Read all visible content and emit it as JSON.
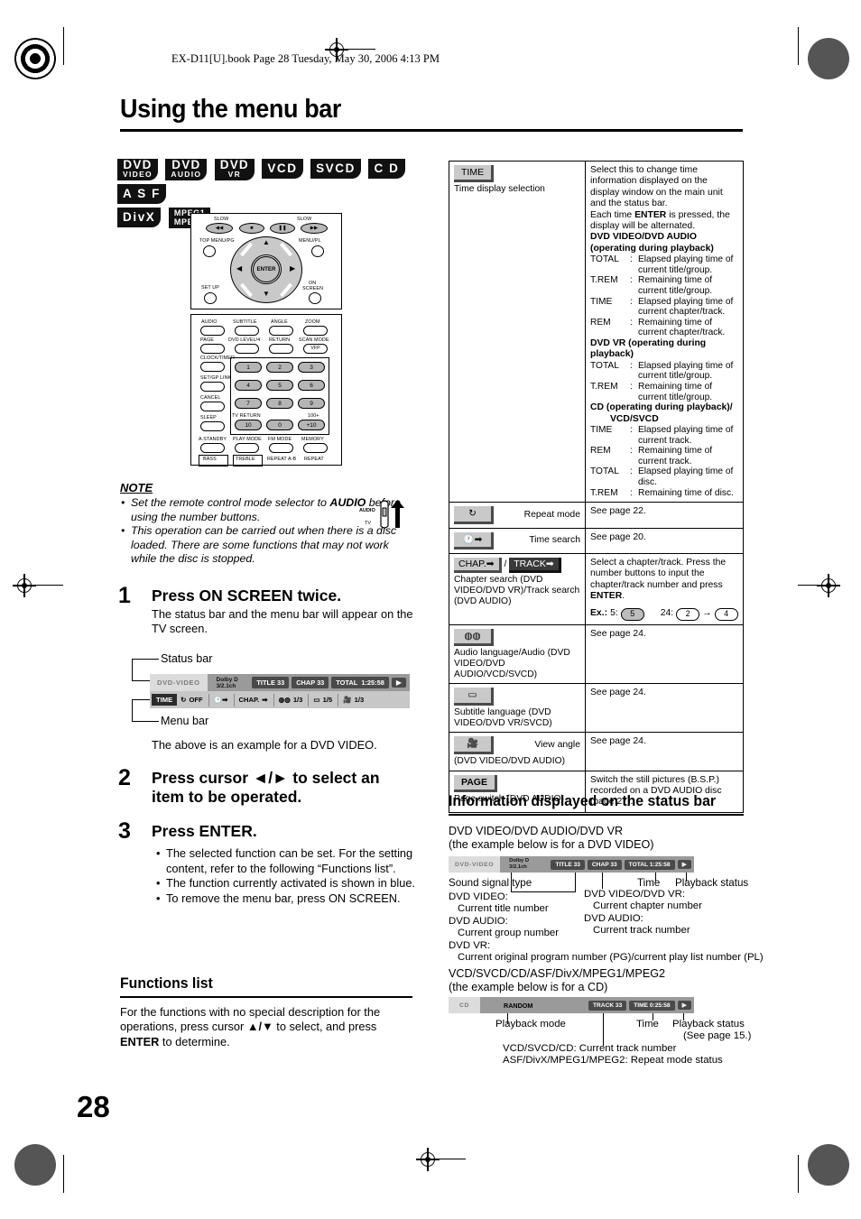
{
  "header": {
    "book_line": "EX-D11[U].book  Page 28  Tuesday, May 30, 2006  4:13 PM",
    "title": "Using the menu bar",
    "page_number": "28"
  },
  "badges": [
    {
      "line1": "DVD",
      "line2": "VIDEO"
    },
    {
      "line1": "DVD",
      "line2": "AUDIO"
    },
    {
      "line1": "DVD",
      "line2": "VR"
    },
    {
      "line1": "VCD",
      "line2": ""
    },
    {
      "line1": "SVCD",
      "line2": ""
    },
    {
      "line1": "C D",
      "line2": ""
    },
    {
      "line1": "A S F",
      "line2": ""
    },
    {
      "line1": "DivX",
      "line2": ""
    },
    {
      "line1": "MPEG1",
      "line2": "MPEG2"
    }
  ],
  "remote": {
    "slow_left": "SLOW",
    "slow_right": "SLOW",
    "top_menu": "TOP MENU/PG",
    "menu_pl": "MENU/PL",
    "set_up": "SET UP",
    "on_screen_l1": "ON",
    "on_screen_l2": "SCREEN",
    "enter": "ENTER",
    "row_labels": [
      "AUDIO",
      "SUBTITLE",
      "ANGLE",
      "ZOOM",
      "PAGE",
      "DVD LEVEL/4",
      "RETURN",
      "SCAN MODE",
      "CLOCK/TIMER",
      "SET/GP LINK",
      "CANCEL",
      "SLEEP",
      "TV RETURN",
      "100+",
      "A.STANDBY",
      "PLAY MODE",
      "FM MODE",
      "MEMORY",
      "BASS",
      "TREBLE",
      "REPEAT A-B",
      "REPEAT"
    ],
    "vfp": "VFP",
    "number_keys": [
      "1",
      "2",
      "3",
      "4",
      "5",
      "6",
      "7",
      "8",
      "9",
      "10",
      "0",
      "+10"
    ]
  },
  "note": {
    "heading": "NOTE",
    "items": [
      {
        "pre": "Set the remote control mode selector to ",
        "bold": "AUDIO",
        "post": " before using the number buttons."
      },
      {
        "pre": "This operation can be carried out when there is a disc loaded. There are some functions that may not work while the disc is stopped.",
        "bold": "",
        "post": ""
      }
    ],
    "selector_top": "AUDIO",
    "selector_bottom": "TV"
  },
  "steps": [
    {
      "num": "1",
      "head": "Press ON SCREEN twice.",
      "body": "The status bar and the menu bar will appear on the TV screen."
    },
    {
      "num": "2",
      "head": "Press cursor ◄/► to select an item to be operated."
    },
    {
      "num": "3",
      "head": "Press ENTER."
    }
  ],
  "step1_labels": {
    "status_bar": "Status bar",
    "menu_bar": "Menu bar",
    "caption": "The above is an example for a DVD VIDEO."
  },
  "step3_bullets": [
    "The selected function can be set. For the setting content, refer to the following “Functions list”.",
    "The function currently activated is shown in blue.",
    "To remove the menu bar, press ON SCREEN."
  ],
  "functions_list": {
    "heading": "Functions list",
    "body_1": "For the functions with no special description for the operations, press cursor ",
    "body_arrows": "▲/▼",
    "body_2": " to select, and press ",
    "body_bold": "ENTER",
    "body_3": " to determine."
  },
  "example_statusbar": {
    "disc": "DVD-VIDEO",
    "signal_l1": "Dolby D",
    "signal_l2": "3/2.1ch",
    "title": "TITLE 33",
    "chap": "CHAP 33",
    "total_label": "TOTAL",
    "total_value": "1:25:58",
    "play_icon": "▶"
  },
  "example_menubar": {
    "time": "TIME",
    "repeat": "OFF",
    "chapter": "CHAP.",
    "audio": "1/3",
    "subtitle": "1/5",
    "angle": "1/3"
  },
  "table": {
    "rows": [
      {
        "btn": "TIME",
        "btn_style": "light",
        "caption": "Time display selection",
        "desc_paras": [
          {
            "type": "text",
            "text": "Select this to change time information displayed on the display window on the main unit and the status bar."
          },
          {
            "type": "rich",
            "pre": "Each time ",
            "bold": "ENTER",
            "post": " is pressed, the display will be alternated."
          },
          {
            "type": "bold",
            "text": "DVD VIDEO/DVD AUDIO"
          },
          {
            "type": "bold",
            "text": "(operating during playback)"
          },
          {
            "type": "def",
            "k": "TOTAL",
            "v": "Elapsed playing time of current title/group."
          },
          {
            "type": "def",
            "k": "T.REM",
            "v": "Remaining time of current title/group."
          },
          {
            "type": "def",
            "k": "TIME",
            "v": "Elapsed playing time of current chapter/track."
          },
          {
            "type": "def",
            "k": "REM",
            "v": "Remaining time of current chapter/track."
          },
          {
            "type": "bold",
            "text": "DVD VR (operating during playback)"
          },
          {
            "type": "def",
            "k": "TOTAL",
            "v": "Elapsed playing time of current title/group."
          },
          {
            "type": "def",
            "k": "T.REM",
            "v": "Remaining time of current title/group."
          },
          {
            "type": "bold",
            "text": "CD (operating during playback)/"
          },
          {
            "type": "bold-indent",
            "text": "VCD/SVCD"
          },
          {
            "type": "def",
            "k": "TIME",
            "v": "Elapsed playing time of current track."
          },
          {
            "type": "def",
            "k": "REM",
            "v": "Remaining time of current track."
          },
          {
            "type": "def",
            "k": "TOTAL",
            "v": "Elapsed playing time of disc."
          },
          {
            "type": "def",
            "k": "T.REM",
            "v": "Remaining time of disc."
          }
        ]
      },
      {
        "btn_icon": "repeat-icon",
        "label_inline": "Repeat mode",
        "desc": "See page 22."
      },
      {
        "btn_icon": "time-search-icon",
        "label_inline": "Time search",
        "desc": "See page 20."
      },
      {
        "btn": "CHAP.",
        "btn2": "TRACK",
        "caption": "Chapter search (DVD VIDEO/DVD VR)/Track search (DVD AUDIO)",
        "desc_pre": "Select a chapter/track. Press the number buttons to input the chapter/track number and press ",
        "desc_bold": "ENTER",
        "desc_post": ".",
        "example_label": "Ex.:",
        "example_a_num": "5:",
        "example_a_key": "5",
        "example_b_num": "24:",
        "example_b_key1": "2",
        "example_b_key2": "4"
      },
      {
        "btn_icon": "audio-icon",
        "caption": "Audio language/Audio (DVD VIDEO/DVD AUDIO/VCD/SVCD)",
        "desc": "See page 24."
      },
      {
        "btn_icon": "subtitle-icon",
        "caption": "Subtitle language (DVD VIDEO/DVD VR/SVCD)",
        "desc": "See page 24."
      },
      {
        "btn_icon": "angle-icon",
        "label_inline": "View angle",
        "caption": "(DVD VIDEO/DVD AUDIO)",
        "desc": "See page 24."
      },
      {
        "btn": "PAGE",
        "caption": "Page switch (DVD AUDIO)",
        "desc": "Switch the still pictures (B.S.P.) recorded on a DVD AUDIO disc (page 27)."
      }
    ]
  },
  "info_section": {
    "heading": "Information displayed on the status bar",
    "dvd_title_l1": "DVD VIDEO/DVD AUDIO/DVD VR",
    "dvd_title_l2": "(the example below is for a DVD VIDEO)",
    "dvd_callouts": {
      "sound_signal": "Sound signal type",
      "time": "Time",
      "playback_status": "Playback status",
      "left_block": [
        "DVD VIDEO:",
        "   Current title number",
        "DVD AUDIO:",
        "   Current group number",
        "DVD VR:",
        "   Current original program number (PG)/current play list number (PL)"
      ],
      "right_block": [
        "DVD VIDEO/DVD VR:",
        "   Current chapter number",
        "DVD AUDIO:",
        "   Current track number"
      ]
    },
    "cd_title_l1": "VCD/SVCD/CD/ASF/DivX/MPEG1/MPEG2",
    "cd_title_l2": "(the example below is for a CD)",
    "cd_statusbar": {
      "disc": "CD",
      "mode": "RANDOM",
      "track": "TRACK 33",
      "time_label": "TIME",
      "time_value": "0:25:58",
      "play_icon": "▶"
    },
    "cd_callouts": {
      "playback_mode": "Playback mode",
      "time": "Time",
      "playback_status_l1": "Playback status",
      "playback_status_l2": "(See page 15.)",
      "track_l1": "VCD/SVCD/CD: Current track number",
      "track_l2": "ASF/DivX/MPEG1/MPEG2: Repeat mode status"
    }
  }
}
